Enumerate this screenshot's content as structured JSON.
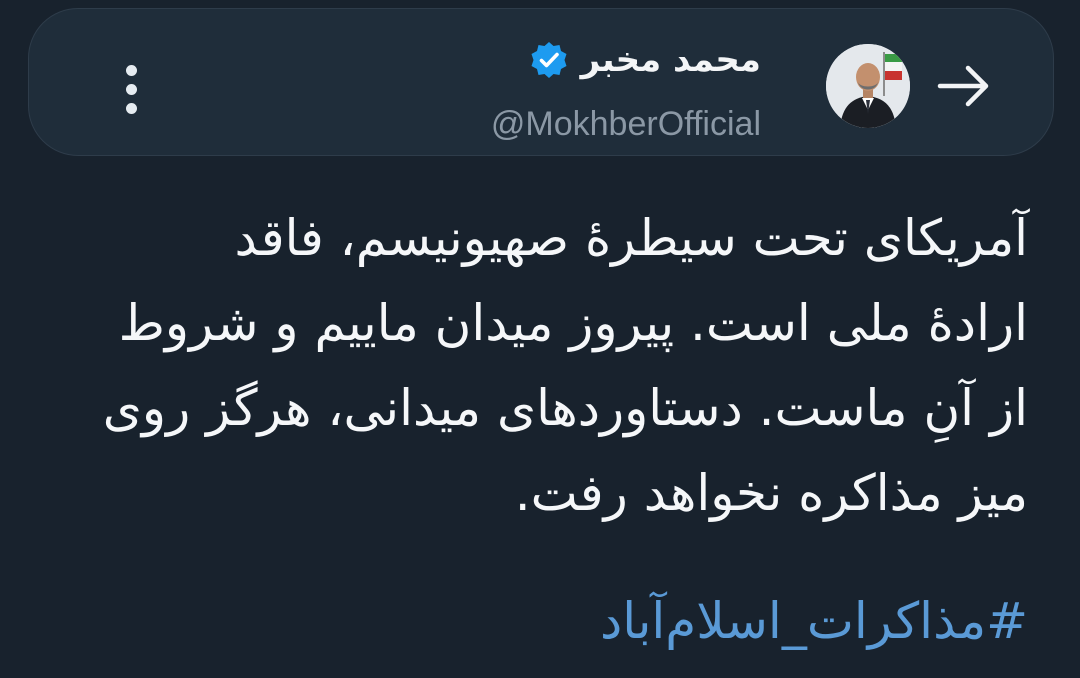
{
  "header": {
    "display_name": "محمد مخبر",
    "handle": "@MokhberOfficial",
    "verified": true,
    "avatar_icon": "profile-photo",
    "back_icon": "arrow-right-icon",
    "menu_icon": "more-vertical-icon"
  },
  "tweet": {
    "lines": [
      "آمریکای تحت سیطرهٔ صهیونیسم، فاقد",
      "ارادهٔ ملی است. پیروز میدان ماییم و شروط",
      "از آنِ ماست. دستاوردهای میدانی، هرگز روی",
      "میز مذاکره نخواهد رفت."
    ],
    "hashtag": "#مذاکرات_اسلام‌آباد"
  },
  "colors": {
    "background": "#18222d",
    "header_background": "#1f2d3a",
    "text": "#f5f7f9",
    "muted": "#8b98a5",
    "link": "#5a9ad6",
    "verified": "#1d9bf0"
  }
}
